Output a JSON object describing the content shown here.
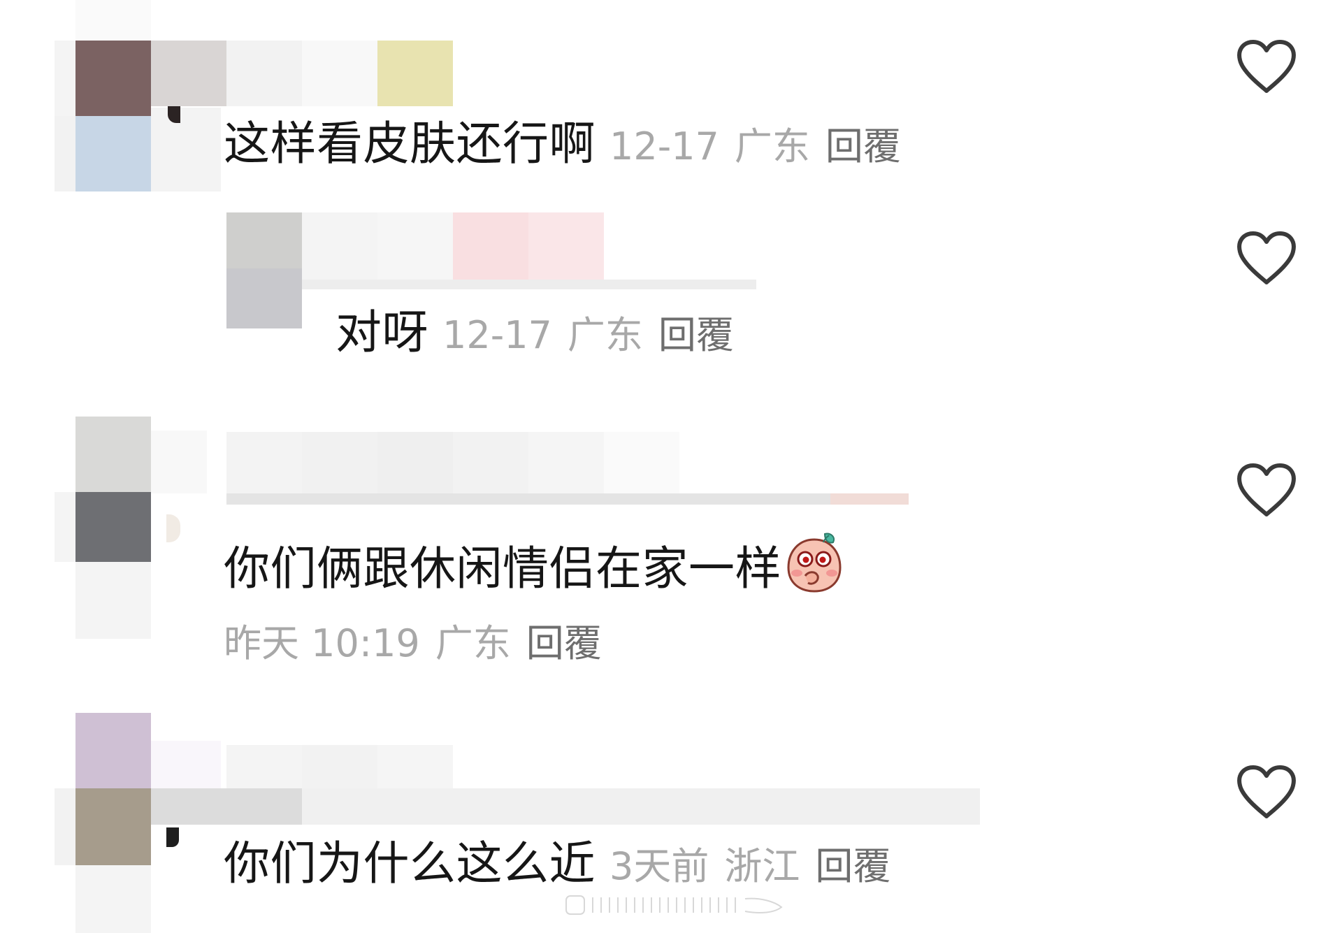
{
  "comments": [
    {
      "text": "这样看皮肤还行啊",
      "date": "12-17",
      "location": "广东",
      "reply_label": "回覆",
      "is_reply": false
    },
    {
      "text": "对呀",
      "date": "12-17",
      "location": "广东",
      "reply_label": "回覆",
      "is_reply": true
    },
    {
      "text": "你们俩跟休闲情侣在家一样",
      "date": "昨天 10:19",
      "location": "广东",
      "reply_label": "回覆",
      "is_reply": false
    },
    {
      "text": "你们为什么这么近",
      "date": "3天前",
      "location": "浙江",
      "reply_label": "回覆",
      "is_reply": false
    }
  ],
  "icons": {
    "like": "heart-outline-icon",
    "emoji": "blushing-peach-emoji-icon"
  },
  "colors": {
    "text": "#161616",
    "meta": "#a8a8a8",
    "reply": "#6e6e6e",
    "heart_stroke": "#3a3a3a"
  }
}
